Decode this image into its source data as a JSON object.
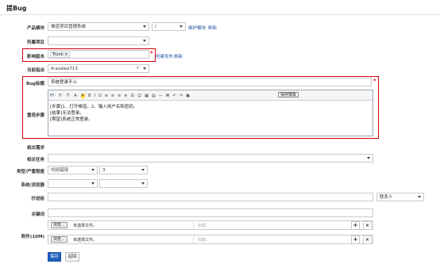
{
  "page": {
    "title": "提Bug"
  },
  "labels": {
    "product": "产品模块",
    "project": "所属项目",
    "build": "影响版本",
    "assigned": "当前指派",
    "bug_title": "Bug标题",
    "steps": "重现步骤",
    "story": "相关需求",
    "task": "相关任务",
    "type_severity": "类型/严重程度",
    "os_browser": "系统/浏览器",
    "cc": "抄送给",
    "keywords": "关键词",
    "files": "附件(10M)"
  },
  "product": {
    "value": "禅道项目管理系统",
    "module": "/",
    "maintain_link": "维护模块",
    "refresh_link": "刷新"
  },
  "build": {
    "tag": "Trunk",
    "create_link": "创建发布",
    "refresh_link": "刷新"
  },
  "assigned": {
    "value": "A:azalea713"
  },
  "bug_title": {
    "value": "系统登录不上"
  },
  "editor": {
    "toolbar": [
      "H¹·",
      "F·",
      "·T·",
      "A·",
      "A·",
      "B",
      "I",
      "U",
      "≡",
      "≡",
      "≡",
      "≡",
      "☰",
      "☺",
      "▦",
      "▤",
      "—",
      "⌘",
      "↶",
      "↷",
      "▣"
    ],
    "save_template": "保存模板",
    "lines": [
      "[步骤]1、打开禅道。2、输入用户名和密码。",
      "[结果]无法登录。",
      "[期望]系统正常登录。"
    ]
  },
  "type": {
    "value": "代码错误",
    "severity": "3"
  },
  "cc": {
    "contacts": "联系人"
  },
  "files": [
    {
      "browse": "浏览...",
      "status": "未选择文件。",
      "title_placeholder": "标题："
    },
    {
      "browse": "浏览...",
      "status": "未选择文件。",
      "title_placeholder": "标题："
    }
  ],
  "actions": {
    "save": "保存",
    "back": "返回"
  },
  "colors": {
    "accent": "#1d5fbd",
    "highlight": "#d4000f"
  }
}
